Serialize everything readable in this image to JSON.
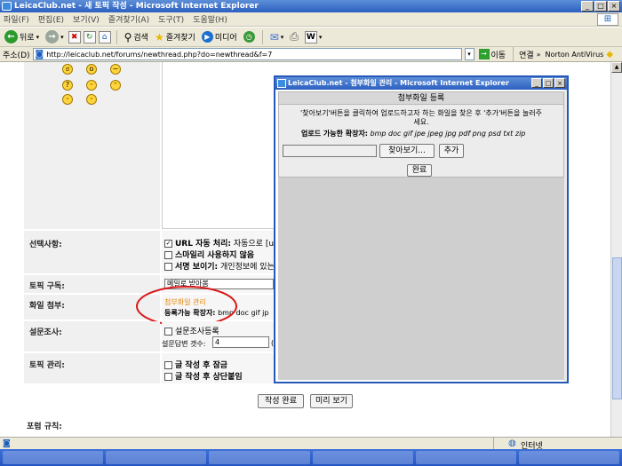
{
  "window": {
    "title": "LeicaClub.net - 새 토픽 작성 - Microsoft Internet Explorer"
  },
  "menubar": [
    "파일(F)",
    "편집(E)",
    "보기(V)",
    "즐겨찾기(A)",
    "도구(T)",
    "도움말(H)"
  ],
  "toolbar": {
    "back": "뒤로",
    "search": "검색",
    "favorites": "즐겨찾기",
    "media": "미디어"
  },
  "address": {
    "label": "주소(D)",
    "url": "http://leicaclub.net/forums/newthread.php?do=newthread&f=7",
    "go": "이동",
    "links": "연결",
    "norton": "Norton AntiVirus"
  },
  "form": {
    "options_label": "선택사항:",
    "url_auto": "URL 자동 처리:",
    "url_auto_desc": "자동으로 [ur",
    "no_smilies": "스마일리 사용하지 않음",
    "signature": "서명 보이기:",
    "signature_desc": "개인정보에 있는",
    "subscribe_label": "토픽 구독:",
    "subscribe_value": "메일로 받아봄",
    "attach_label": "화일 첨부:",
    "attach_link": "첨부화일 관리",
    "allowed_ext_label": "등록가능 확장자:",
    "allowed_ext_short": "bmp doc gif jp",
    "poll_label": "설문조사:",
    "poll_check": "설문조사등록",
    "poll_count_label": "설문답변 갯수:",
    "poll_count_value": "4",
    "poll_paren": "(",
    "manage_label": "토픽 관리:",
    "lock": "글 작성 후 잠금",
    "sticky": "글 작성 후 상단붙임",
    "submit": "작성 완료",
    "preview": "미리 보기",
    "forum_rules": "포럼 규칙:"
  },
  "popup": {
    "title": "LeicaClub.net - 첨부화일 관리 - Microsoft Internet Explorer",
    "heading": "첨부화일 등록",
    "instructions_1": "'찾아보기'버튼을 클릭하여 업로드하고자 하는 화일을 찾은 후 '추가'버튼을 눌러주",
    "instructions_2": "세요.",
    "ext_label": "업로드 가능한 확장자:",
    "ext_list": "bmp doc gif jpe jpeg jpg pdf png psd txt zip",
    "browse": "찾아보기...",
    "add": "추가",
    "done": "완료"
  },
  "status": {
    "zone": "인터넷"
  },
  "colors": {
    "annotation_circle": "#d81818",
    "link_orange": "#e8850a",
    "title_blue": "#2c5fc0"
  }
}
